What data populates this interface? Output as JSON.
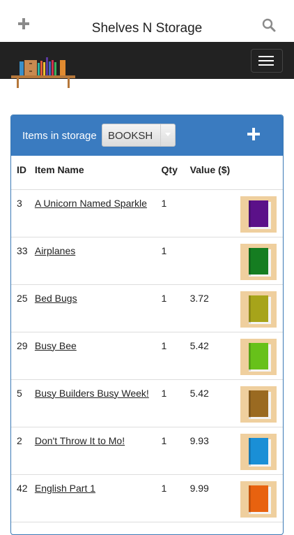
{
  "header": {
    "title": "Shelves N Storage"
  },
  "panel": {
    "storage_label": "Items in storage",
    "storage_select_value": "BOOKSH"
  },
  "table": {
    "headers": {
      "id": "ID",
      "name": "Item Name",
      "qty": "Qty",
      "value": "Value ($)"
    },
    "rows": [
      {
        "id": "3",
        "name": "A Unicorn Named Sparkle",
        "qty": "1",
        "value": "",
        "book_color": "#5b1189"
      },
      {
        "id": "33",
        "name": "Airplanes",
        "qty": "1",
        "value": "",
        "book_color": "#157d21"
      },
      {
        "id": "25",
        "name": "Bed Bugs",
        "qty": "1",
        "value": "3.72",
        "book_color": "#a7a41a"
      },
      {
        "id": "29",
        "name": "Busy Bee",
        "qty": "1",
        "value": "5.42",
        "book_color": "#67c11a"
      },
      {
        "id": "5",
        "name": "Busy Builders Busy Week!",
        "qty": "1",
        "value": "5.42",
        "book_color": "#9a6a21"
      },
      {
        "id": "2",
        "name": "Don't Throw It to Mo!",
        "qty": "1",
        "value": "9.93",
        "book_color": "#1a8fd6"
      },
      {
        "id": "42",
        "name": "English Part 1",
        "qty": "1",
        "value": "9.99",
        "book_color": "#e8620f"
      }
    ]
  },
  "icons": {
    "add_top": "plus-icon",
    "search": "search-icon",
    "menu": "hamburger-icon",
    "add_item": "plus-icon",
    "logo": "bookshelf-logo"
  }
}
